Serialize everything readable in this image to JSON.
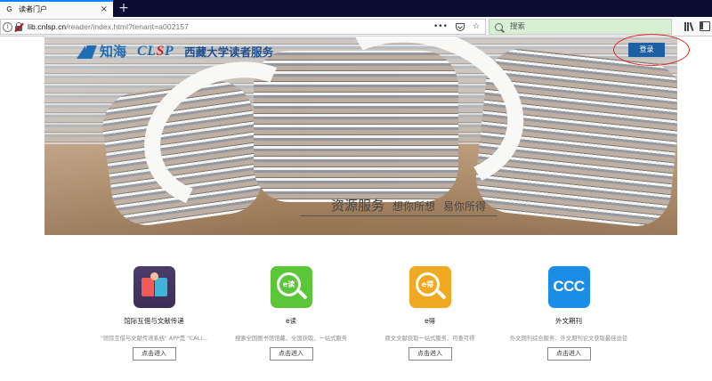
{
  "browser": {
    "tab": {
      "title": "读者门户",
      "favicon": "G"
    },
    "url": {
      "host": "lib.cnlsp.cn",
      "path": "/reader/index.html?tenant=a002157"
    },
    "search_placeholder": "搜索"
  },
  "header": {
    "brand_cn": "知海",
    "brand_en_a": "CL",
    "brand_en_b": "S",
    "brand_en_c": "P",
    "org_name": "西藏大学读者服务",
    "login_label": "登录"
  },
  "hero": {
    "slogan_main": "资源服务",
    "slogan_sub1": "想你所想",
    "slogan_sub2": "易你所得"
  },
  "services": [
    {
      "title": "馆际互借与文献传递",
      "desc": "\"馆际互借与文献传递系统\" APP是 \"CALI...",
      "button": "点击进入",
      "icon": "ill-icon"
    },
    {
      "title": "e读",
      "desc": "搜索全国图书馆馆藏、全国获取、一站式服务",
      "button": "点击进入",
      "icon": "eread-icon",
      "icon_text": "e读"
    },
    {
      "title": "e得",
      "desc": "原文文献获取一站式服务、可查可得",
      "button": "点击进入",
      "icon": "edoc-icon",
      "icon_text": "e得"
    },
    {
      "title": "外文期刊",
      "desc": "外文期刊综合服务、外文期刊论文获取最佳途径",
      "button": "点击进入",
      "icon": "ccc-icon",
      "icon_text": "CCC"
    }
  ]
}
